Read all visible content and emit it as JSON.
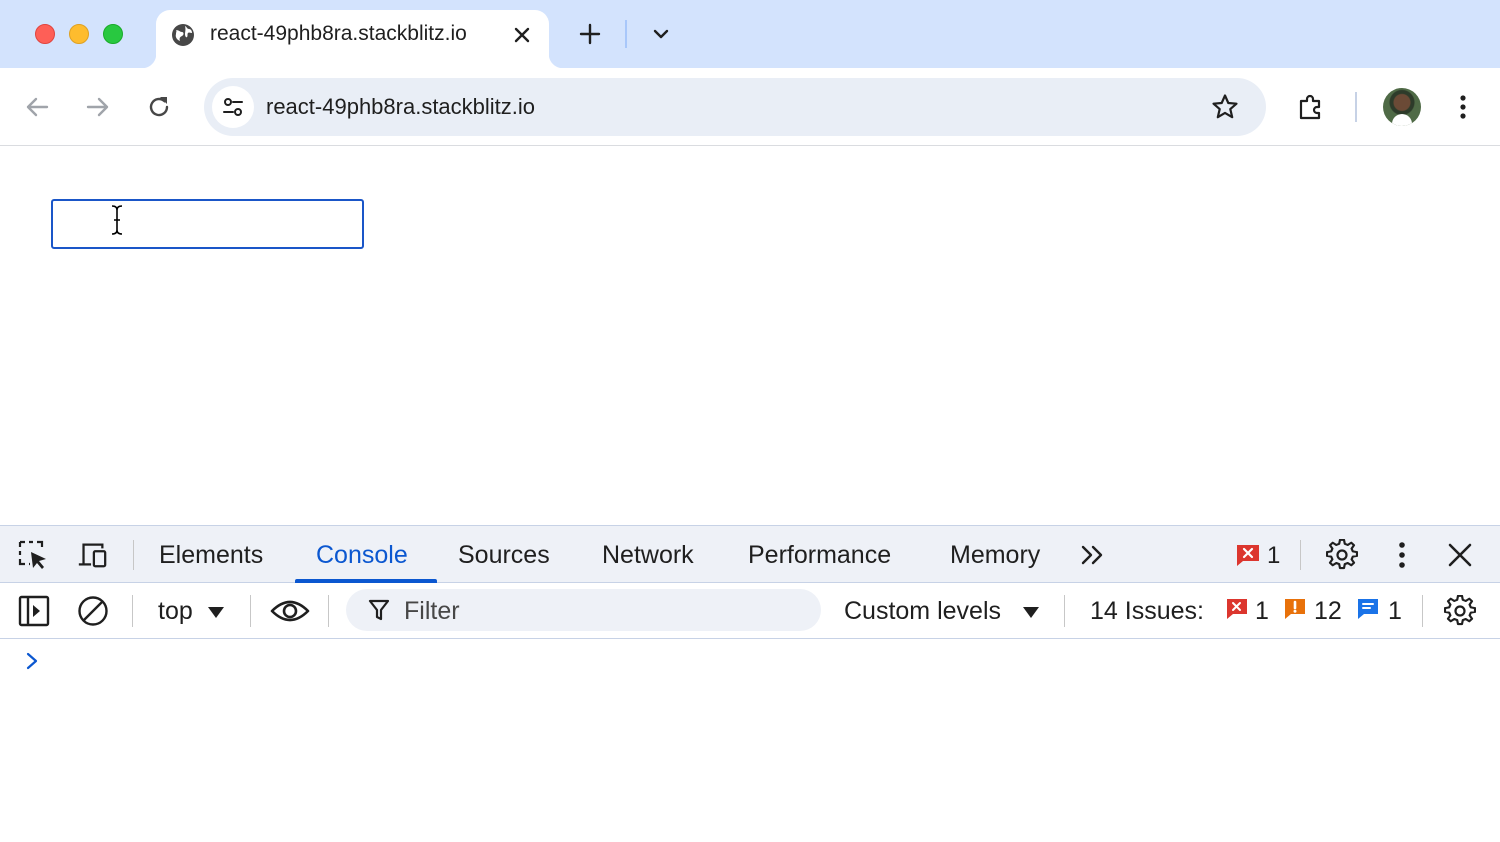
{
  "browser": {
    "tab": {
      "title": "react-49phb8ra.stackblitz.io",
      "favicon": "globe-icon"
    },
    "omnibox": {
      "url": "react-49phb8ra.stackblitz.io"
    }
  },
  "page": {
    "input_value": ""
  },
  "devtools": {
    "tabs": [
      "Elements",
      "Console",
      "Sources",
      "Network",
      "Performance",
      "Memory"
    ],
    "active_tab": "Console",
    "error_badge_count": "1",
    "console_toolbar": {
      "context": "top",
      "filter_placeholder": "Filter",
      "levels": "Custom levels",
      "issues_label": "14 Issues:",
      "issue_errors": "1",
      "issue_warnings": "12",
      "issue_info": "1"
    }
  },
  "colors": {
    "tabstrip_bg": "#d3e3fd",
    "accent": "#0b57d0",
    "error": "#dc362e",
    "warning": "#e8710a",
    "info": "#1a73e8"
  }
}
